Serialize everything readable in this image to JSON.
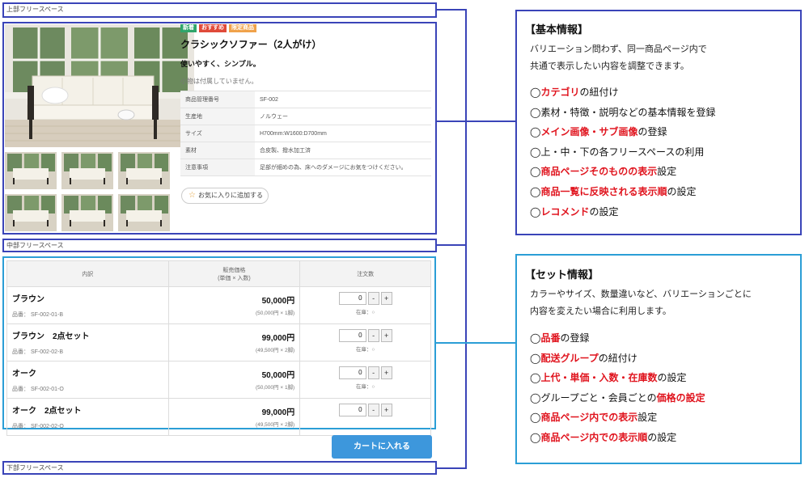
{
  "spaces": {
    "top": "上部フリースペース",
    "middle": "中部フリースペース",
    "bottom": "下部フリースペース"
  },
  "product": {
    "badges": [
      {
        "label": "新着",
        "color": "#2fa56b"
      },
      {
        "label": "おすすめ",
        "color": "#e04a3a"
      },
      {
        "label": "限定商品",
        "color": "#f0a24a"
      }
    ],
    "title": "クラシックソファー（2人がけ）",
    "catch": "使いやすく、シンプル。",
    "note": "小物は付属していません。",
    "specs": [
      {
        "key": "商品管理番号",
        "value": "SF-002"
      },
      {
        "key": "生産地",
        "value": "ノルウェー"
      },
      {
        "key": "サイズ",
        "value": "H700mm:W1600:D700mm"
      },
      {
        "key": "素材",
        "value": "合皮製、撥水加工済"
      },
      {
        "key": "注意事項",
        "value": "足部が細めの為、床へのダメージにお気をつけください。"
      }
    ],
    "favorite_label": "お気に入りに追加する"
  },
  "set_table": {
    "headers": {
      "item": "内訳",
      "price_line1": "販売価格",
      "price_line2": "(単価 × 入数)",
      "qty": "注文数"
    },
    "rows": [
      {
        "name": "ブラウン",
        "code": "品番： SF-002-01-B",
        "price": "50,000円",
        "detail": "(50,000円 × 1脚)",
        "qty": "0",
        "stock": "在庫：○"
      },
      {
        "name": "ブラウン　2点セット",
        "code": "品番： SF-002-02-B",
        "price": "99,000円",
        "detail": "(49,500円 × 2脚)",
        "qty": "0",
        "stock": "在庫：○"
      },
      {
        "name": "オーク",
        "code": "品番： SF-002-01-O",
        "price": "50,000円",
        "detail": "(50,000円 × 1脚)",
        "qty": "0",
        "stock": "在庫：○"
      },
      {
        "name": "オーク　2点セット",
        "code": "品番： SF-002-02-O",
        "price": "99,000円",
        "detail": "(49,500円 × 2脚)",
        "qty": "0",
        "stock": ""
      }
    ],
    "minus": "-",
    "plus": "+"
  },
  "cart_button": "カートに入れる",
  "info_basic": {
    "heading": "【基本情報】",
    "desc1": "バリエーション問わず、同一商品ページ内で",
    "desc2": "共通で表示したい内容を調整できます。",
    "items": [
      {
        "circle": "◯",
        "red": "カテゴリ",
        "rest": "の紐付け"
      },
      {
        "circle": "◯",
        "red": "",
        "rest": "素材・特徴・説明などの基本情報を登録"
      },
      {
        "circle": "◯",
        "red": "メイン画像・サブ画像",
        "rest": "の登録"
      },
      {
        "circle": "◯",
        "red": "",
        "rest": "上・中・下の各フリースペースの利用"
      },
      {
        "circle": "◯",
        "red": "商品ページそのものの表示",
        "rest": "設定"
      },
      {
        "circle": "◯",
        "red": "商品一覧に反映される表示順",
        "rest": "の設定"
      },
      {
        "circle": "◯",
        "red": "レコメンド",
        "rest": "の設定"
      }
    ]
  },
  "info_set": {
    "heading": "【セット情報】",
    "desc1": "カラーやサイズ、数量違いなど、バリエーションごとに",
    "desc2": "内容を変えたい場合に利用します。",
    "items": [
      {
        "circle": "◯",
        "pre": "",
        "red": "品番",
        "rest": "の登録"
      },
      {
        "circle": "◯",
        "pre": "",
        "red": "配送グループ",
        "rest": "の紐付け"
      },
      {
        "circle": "◯",
        "pre": "",
        "red": "上代・単価・入数・在庫数",
        "rest": "の設定"
      },
      {
        "circle": "◯",
        "pre": "グループごと・会員ごとの",
        "red": "価格の設定",
        "rest": ""
      },
      {
        "circle": "◯",
        "pre": "",
        "red": "商品ページ内での表示",
        "rest": "設定"
      },
      {
        "circle": "◯",
        "pre": "",
        "red": "商品ページ内での表示順",
        "rest": "の設定"
      }
    ]
  },
  "colors": {
    "basic_border": "#3a44b8",
    "set_border": "#2b9ed6",
    "emphasis_red": "#e0141e",
    "cart_blue": "#3d97dc"
  }
}
